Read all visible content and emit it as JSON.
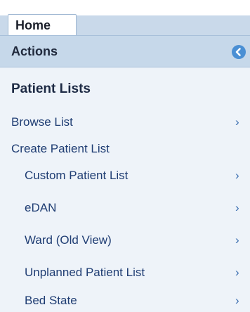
{
  "tabs": {
    "home_label": "Home"
  },
  "actions": {
    "title": "Actions"
  },
  "patient_lists": {
    "title": "Patient Lists",
    "browse_list": "Browse List",
    "create_patient_list": "Create Patient List",
    "sub_items": [
      {
        "label": "Custom Patient List"
      },
      {
        "label": "eDAN"
      },
      {
        "label": "Ward (Old View)"
      },
      {
        "label": "Unplanned Patient List"
      },
      {
        "label": "Bed State"
      }
    ],
    "chevron": "›"
  },
  "icons": {
    "collapse": "chevron-left-circle-icon",
    "item_arrow": "chevron-right-icon"
  },
  "colors": {
    "accent": "#4a8fd4",
    "link": "#1f3d73",
    "panel": "#eef3f9",
    "header": "#c6d8ea"
  }
}
